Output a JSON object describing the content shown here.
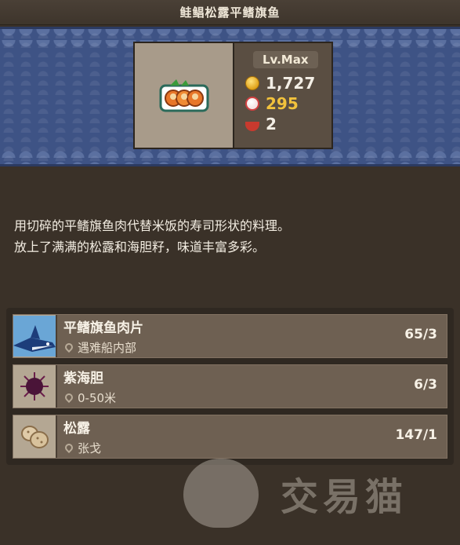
{
  "header": {
    "title": "鲑鲳松露平鳍旗鱼"
  },
  "dish": {
    "level": "Lv.Max",
    "stats": [
      {
        "icon": "coin-icon",
        "value": "1,727",
        "color": "#f4efe6"
      },
      {
        "icon": "heart-icon",
        "value": "295",
        "color": "#f2c23c"
      },
      {
        "icon": "bowl-icon",
        "value": "2",
        "color": "#f4efe6"
      }
    ]
  },
  "description": {
    "line1": "用切碎的平鳍旗鱼肉代替米饭的寿司形状的料理。",
    "line2": "放上了满满的松露和海胆籽，味道丰富多彩。"
  },
  "ingredients": [
    {
      "name": "平鳍旗鱼肉片",
      "location": "遇难船内部",
      "count": "65/3",
      "icon": "marlin-icon"
    },
    {
      "name": "紫海胆",
      "location": "0-50米",
      "count": "6/3",
      "icon": "sea-urchin-icon"
    },
    {
      "name": "松露",
      "location": "张戈",
      "count": "147/1",
      "icon": "truffle-icon"
    }
  ],
  "watermark": {
    "text": "交易猫"
  }
}
